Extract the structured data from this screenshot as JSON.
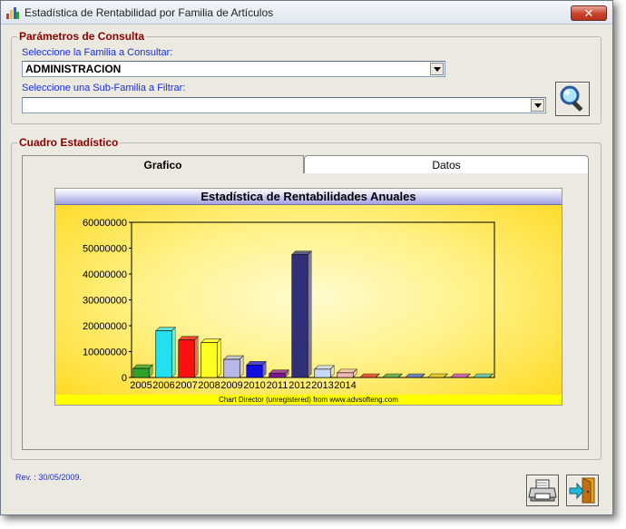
{
  "window": {
    "title": "Estadística de Rentabilidad por Familia de Artículos",
    "close_label": "✕"
  },
  "params": {
    "legend": "Parámetros de Consulta",
    "family_label": "Seleccione la Familia a Consultar:",
    "family_value": "ADMINISTRACION",
    "subfamily_label": "Seleccione una Sub-Familia a Filtrar:",
    "subfamily_value": ""
  },
  "stats": {
    "legend": "Cuadro Estadístico",
    "tabs": [
      {
        "label": "Grafico",
        "active": true
      },
      {
        "label": "Datos",
        "active": false
      }
    ]
  },
  "chart_data": {
    "type": "bar",
    "title": "Estadística de Rentabilidades Anuales",
    "categories": [
      "2005",
      "2006",
      "2007",
      "2008",
      "2009",
      "2010",
      "2011",
      "2012",
      "2013",
      "2014",
      "",
      "",
      "",
      "",
      "",
      ""
    ],
    "values": [
      3500000,
      18000000,
      14500000,
      13500000,
      7000000,
      4800000,
      1500000,
      47500000,
      3200000,
      1800000,
      0,
      0,
      0,
      0,
      0,
      0
    ],
    "colors": [
      "#2aa52a",
      "#22e0f0",
      "#ff1010",
      "#ffff20",
      "#b8b8e8",
      "#1010e0",
      "#8010a0",
      "#303078",
      "#c8d8f8",
      "#f0b8b8",
      "#e03020",
      "#40a040",
      "#4060d0",
      "#e0c020",
      "#c040c0",
      "#40c0c0"
    ],
    "ylim": [
      0,
      60000000
    ],
    "yticks": [
      "0",
      "10000000",
      "20000000",
      "30000000",
      "40000000",
      "50000000",
      "60000000"
    ],
    "credit": "Chart Director (unregistered) from www.advsofteng.com"
  },
  "footer": {
    "revision": "Rev. : 30/05/2009."
  }
}
